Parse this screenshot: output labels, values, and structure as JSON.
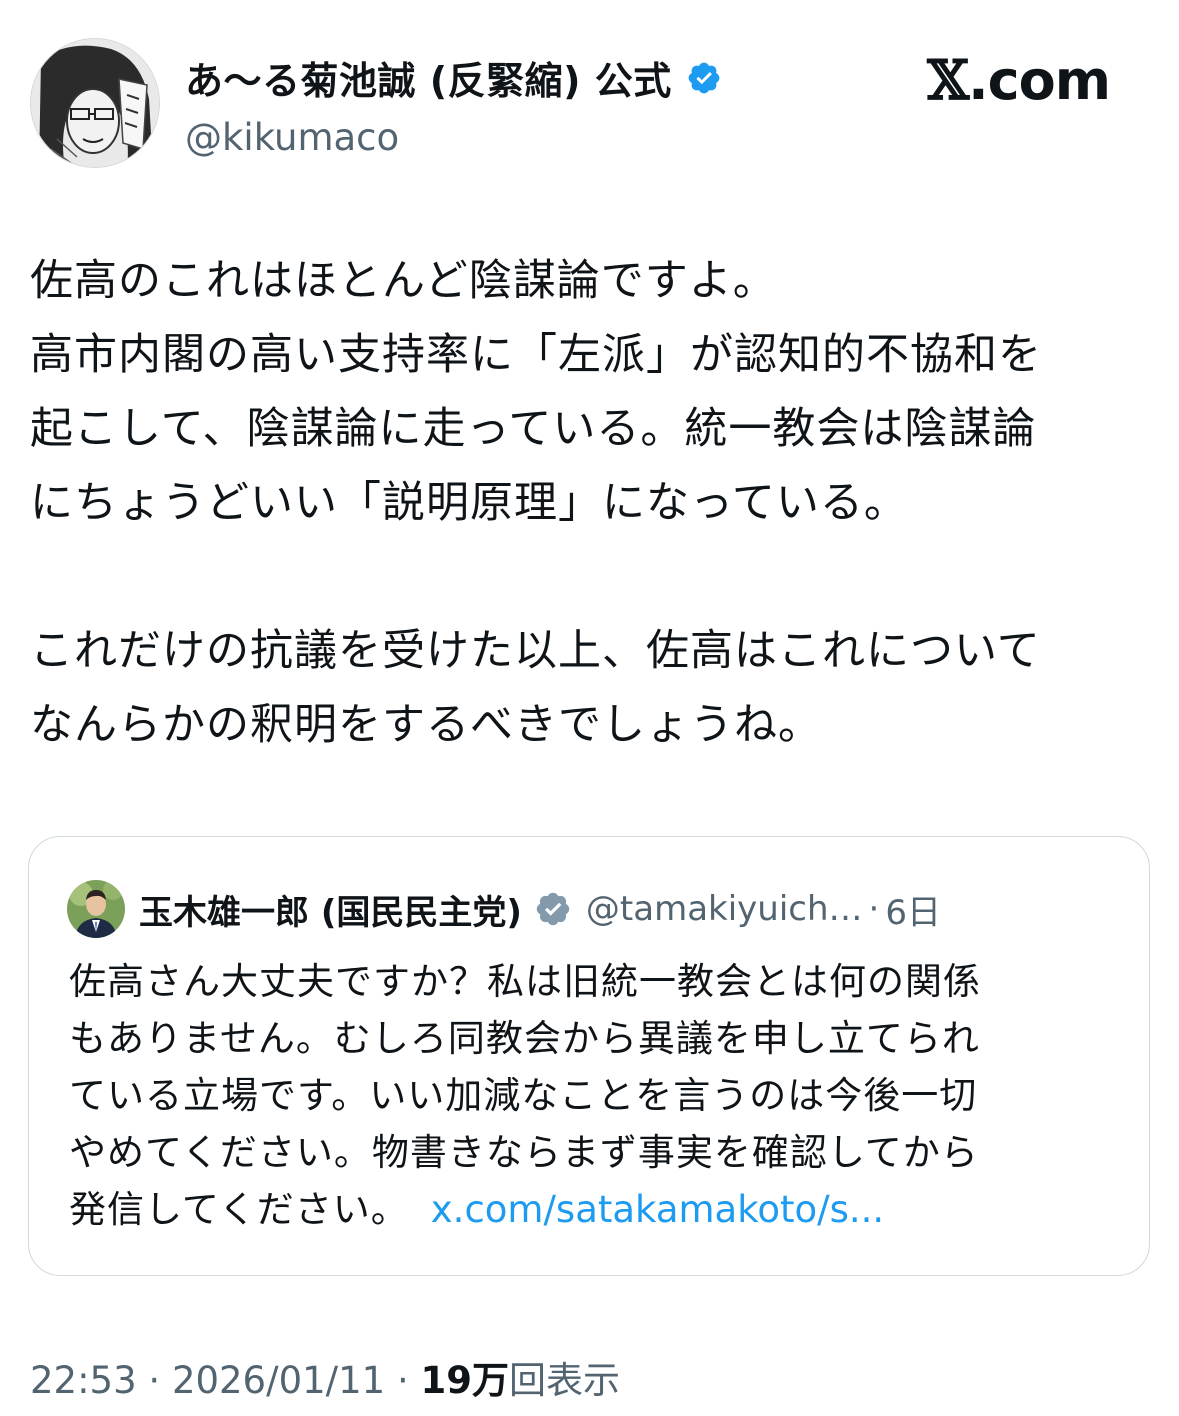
{
  "author": {
    "display_name": "あ〜る菊池誠 (反緊縮) 公式",
    "handle": "@kikumaco",
    "verified": true,
    "avatar_icon": "manga-portrait-avatar"
  },
  "brand": {
    "x_mark": "𝕏",
    "suffix": ".com"
  },
  "tweet": {
    "lines": [
      "佐高のこれはほとんど陰謀論ですよ。",
      "高市内閣の高い支持率に「左派」が認知的不協和を",
      "起こして、陰謀論に走っている。統一教会は陰謀論",
      "にちょうどいい「説明原理」になっている。",
      "",
      "これだけの抗議を受けた以上、佐高はこれについて",
      "なんらかの釈明をするべきでしょうね。"
    ]
  },
  "quote": {
    "display_name": "玉木雄一郎 (国民民主党)",
    "handle": "@tamakiyuich…",
    "separator": "·",
    "time": "6日",
    "verified_color": "#829aab",
    "lines": [
      "佐高さん大丈夫ですか？私は旧統一教会とは何の関係",
      "もありません。むしろ同教会から異議を申し立てられ",
      "ている立場です。いい加減なことを言うのは今後一切",
      "やめてください。物書きならまず事実を確認してから",
      "発信してください。"
    ],
    "link": "x.com/satakamakoto/s..."
  },
  "meta": {
    "time": "22:53",
    "separator": "·",
    "date": "2026/01/11",
    "views_count": "19万",
    "views_label": "回表示"
  },
  "colors": {
    "text": "#0f1419",
    "secondary": "#536471",
    "link": "#1d9bf0",
    "verified_blue": "#1d9bf0",
    "border": "#cfd9de"
  }
}
